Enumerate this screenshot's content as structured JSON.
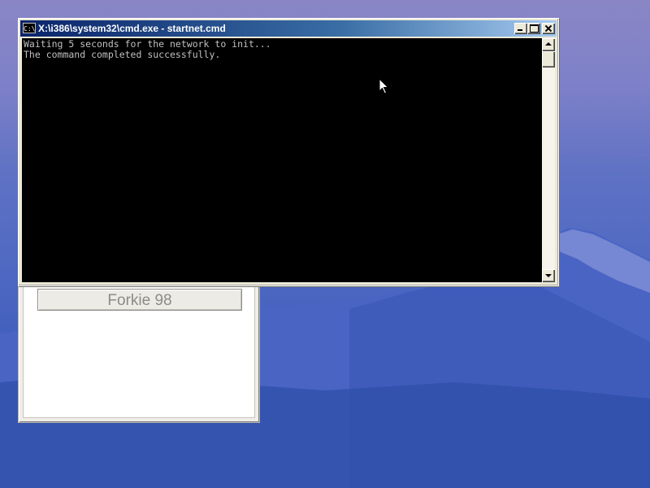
{
  "desktop": {
    "wallpaper": "mountain-wallpaper"
  },
  "background_window": {
    "button_label": "Forkie 98"
  },
  "cmd_window": {
    "title": "X:\\i386\\system32\\cmd.exe - startnet.cmd",
    "icon": "cmd-icon",
    "icon_text": "C:\\",
    "console_lines": [
      "Waiting 5 seconds for the network to init...",
      "The command completed successfully."
    ]
  },
  "cursor": {
    "icon": "mouse-pointer-icon"
  },
  "colors": {
    "console_background": "#000000",
    "console_text": "#c0c0c0",
    "titlebar_start": "#0a246a",
    "titlebar_end": "#a6caf0",
    "desktop_sky": "#8a86c6",
    "desktop_mountain": "#3f5ec0"
  }
}
